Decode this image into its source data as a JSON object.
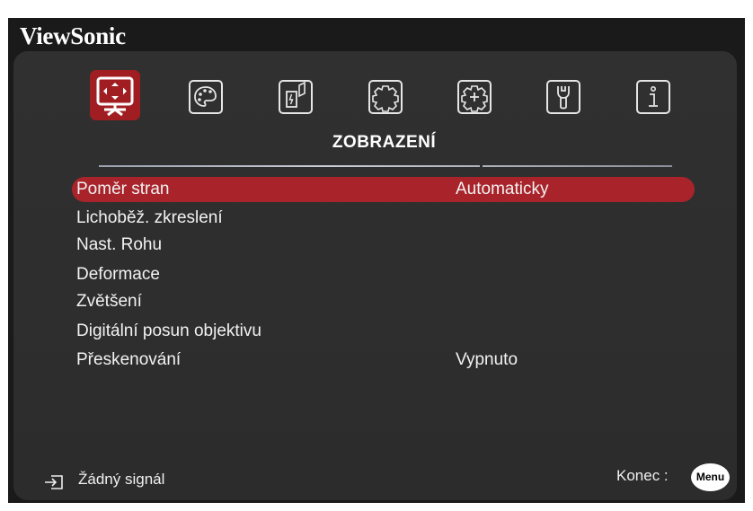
{
  "brand": "ViewSonic",
  "tabs": [
    {
      "icon": "display-icon",
      "selected": true
    },
    {
      "icon": "picture-icon",
      "selected": false
    },
    {
      "icon": "power-management-icon",
      "selected": false
    },
    {
      "icon": "basic-settings-icon",
      "selected": false
    },
    {
      "icon": "advanced-settings-icon",
      "selected": false
    },
    {
      "icon": "system-tools-icon",
      "selected": false
    },
    {
      "icon": "information-icon",
      "selected": false
    }
  ],
  "section_title": "ZOBRAZENÍ",
  "menu": [
    {
      "label": "Poměr stran",
      "value": "Automaticky",
      "selected": true
    },
    {
      "label": "Lichoběž. zkreslení",
      "value": ""
    },
    {
      "label": "Nast. Rohu",
      "value": ""
    },
    {
      "label": "Deformace",
      "value": ""
    },
    {
      "label": "Zvětšení",
      "value": ""
    },
    {
      "label": "Digitální posun objektivu",
      "value": ""
    },
    {
      "label": "Přeskenování",
      "value": "Vypnuto"
    }
  ],
  "footer": {
    "signal_text": "Žádný signál",
    "exit_label": "Konec :",
    "menu_button": "Menu"
  },
  "colors": {
    "accent": "#a8242a",
    "panel": "#2e2e2e",
    "frame": "#1a1a1a"
  }
}
